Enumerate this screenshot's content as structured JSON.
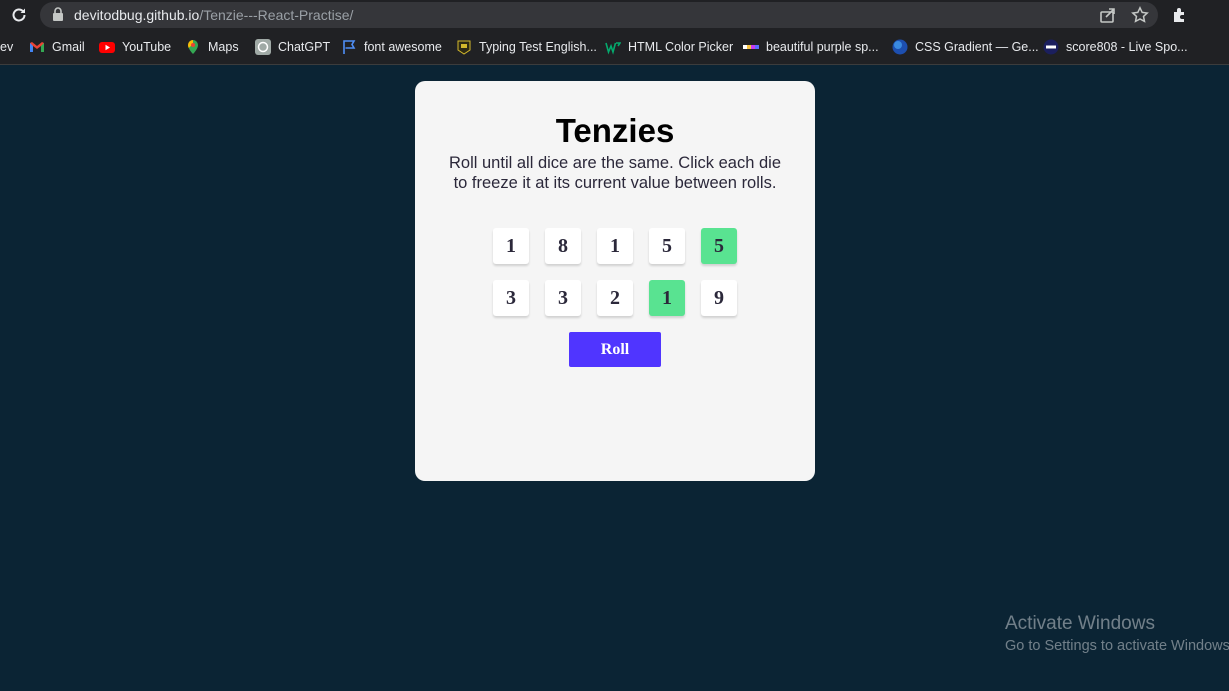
{
  "browser": {
    "url_host": "devitodbug.github.io",
    "url_path": "/Tenzie---React-Practise/"
  },
  "bookmarks": [
    {
      "label": "ev",
      "icon": "partial-bookmark"
    },
    {
      "label": "Gmail",
      "icon": "gmail-icon"
    },
    {
      "label": "YouTube",
      "icon": "youtube-icon"
    },
    {
      "label": "Maps",
      "icon": "maps-icon"
    },
    {
      "label": "ChatGPT",
      "icon": "chatgpt-icon"
    },
    {
      "label": "font awesome",
      "icon": "flag-icon"
    },
    {
      "label": "Typing Test English...",
      "icon": "typing-test-icon"
    },
    {
      "label": "HTML Color Picker",
      "icon": "w3schools-icon"
    },
    {
      "label": "beautiful purple sp...",
      "icon": "gradient-bar-icon"
    },
    {
      "label": "CSS Gradient — Ge...",
      "icon": "css-gradient-icon"
    },
    {
      "label": "score808 - Live Spo...",
      "icon": "live-icon"
    }
  ],
  "app": {
    "title": "Tenzies",
    "instructions": "Roll until all dice are the same. Click each die to freeze it at its current value between rolls.",
    "dice": [
      {
        "value": "1",
        "held": false
      },
      {
        "value": "8",
        "held": false
      },
      {
        "value": "1",
        "held": false
      },
      {
        "value": "5",
        "held": false
      },
      {
        "value": "5",
        "held": true
      },
      {
        "value": "3",
        "held": false
      },
      {
        "value": "3",
        "held": false
      },
      {
        "value": "2",
        "held": false
      },
      {
        "value": "1",
        "held": true
      },
      {
        "value": "9",
        "held": false
      }
    ],
    "roll_label": "Roll",
    "colors": {
      "background": "#0b2434",
      "card": "#f5f5f5",
      "held_die": "#59e391",
      "button": "#5035ff"
    }
  },
  "watermark": {
    "title": "Activate Windows",
    "subtitle": "Go to Settings to activate Windows."
  }
}
